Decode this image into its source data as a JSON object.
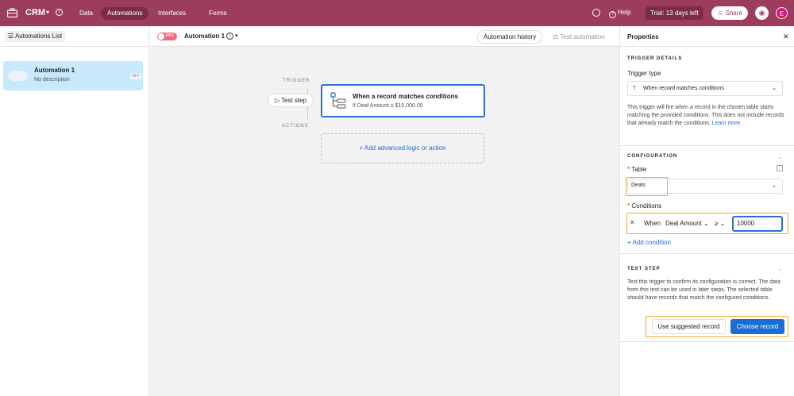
{
  "topbar": {
    "app_name": "CRM",
    "tabs": [
      {
        "label": "Data",
        "active": false
      },
      {
        "label": "Automations",
        "active": true
      },
      {
        "label": "Interfaces",
        "active": false
      },
      {
        "label": "Forms",
        "active": false
      }
    ],
    "help_label": "Help",
    "trial_label": "Trial: 13 days left",
    "share_label": "Share",
    "avatar_letter": "E",
    "bar_color": "#9c3d5e"
  },
  "sidebar": {
    "list_button_label": "Automations List",
    "automations": [
      {
        "name": "Automation 1",
        "description": "No description",
        "status": "OFF"
      }
    ]
  },
  "canvas_header": {
    "toggle_label": "OFF",
    "automation_name": "Automation 1",
    "history_label": "Automation history",
    "test_label": "Test automation"
  },
  "canvas": {
    "trigger_label": "TRIGGER",
    "actions_label": "ACTIONS",
    "test_step_label": "Test step",
    "trigger_title": "When a record matches conditions",
    "trigger_subtitle": "If Deal Amount ≥ $10,000.00",
    "add_action_label": "Add advanced logic or action"
  },
  "properties": {
    "title": "Properties",
    "trigger_details_heading": "TRIGGER DETAILS",
    "trigger_type_label": "Trigger type",
    "trigger_type_value": "When record matches conditions",
    "trigger_description": "This trigger will fire when a record in the chosen table starts matching the provided conditions. This does not include records that already match the conditions.",
    "learn_more_label": "Learn more",
    "configuration_heading": "CONFIGURATION",
    "table_label": "Table",
    "table_value": "Deals",
    "conditions_label": "Conditions",
    "condition": {
      "when_label": "When",
      "field": "Deal Amount",
      "operator": "≥",
      "value": "10000"
    },
    "add_condition_label": "Add condition",
    "test_step_heading": "TEST STEP",
    "test_step_description": "Test this trigger to confirm its configuration is correct. The data from this test can be used in later steps. The selected table should have records that match the configured conditions.",
    "suggested_record_label": "Use suggested record",
    "choose_record_label": "Choose record"
  }
}
